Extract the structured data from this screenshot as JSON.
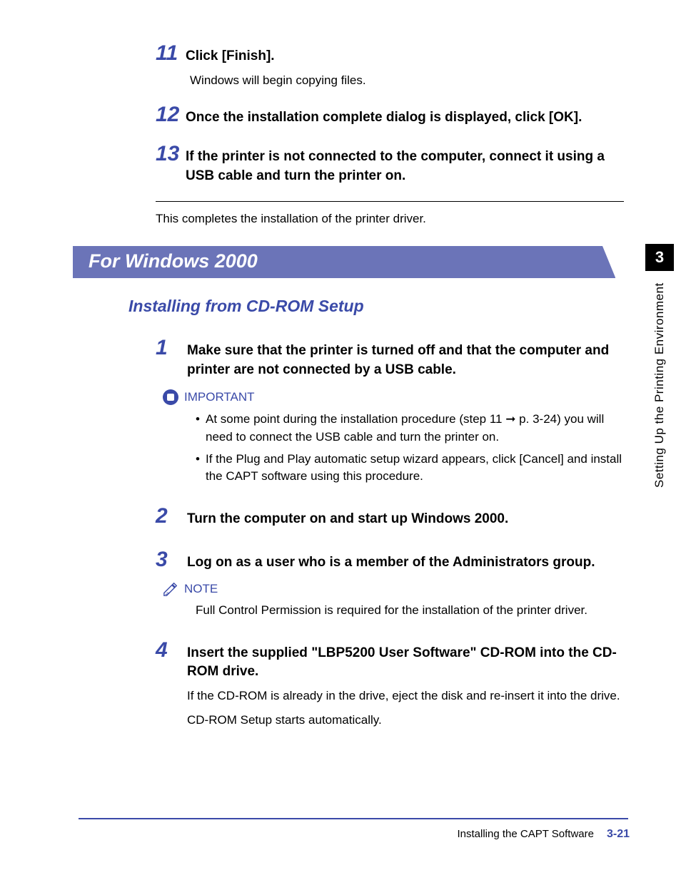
{
  "steps_top": [
    {
      "num": "11",
      "title": "Click [Finish].",
      "body": [
        "Windows will begin copying files."
      ]
    },
    {
      "num": "12",
      "title": "Once the installation complete dialog is displayed, click [OK].",
      "body": []
    },
    {
      "num": "13",
      "title": "If the printer is not connected to the computer, connect it using a USB cable and turn the printer on.",
      "body": []
    }
  ],
  "completion_text": "This completes the installation of the printer driver.",
  "section_heading": "For Windows 2000",
  "subsection_heading": "Installing from CD-ROM Setup",
  "steps_bottom": [
    {
      "num": "1",
      "title": "Make sure that the printer is turned off and that the computer and printer are not connected by a USB cable.",
      "callout": {
        "type": "important",
        "label": "IMPORTANT",
        "bullets": [
          "At some point during the installation procedure (step 11 ➞ p. 3-24) you will need to connect the USB cable and turn the printer on.",
          "If the Plug and Play automatic setup wizard appears, click [Cancel] and install the CAPT software using this procedure."
        ]
      }
    },
    {
      "num": "2",
      "title": "Turn the computer on and start up Windows 2000."
    },
    {
      "num": "3",
      "title": "Log on as a user who is a member of the Administrators group.",
      "callout": {
        "type": "note",
        "label": "NOTE",
        "text": "Full Control Permission is required for the installation of the printer driver."
      }
    },
    {
      "num": "4",
      "title": "Insert the supplied \"LBP5200 User Software\" CD-ROM into the CD-ROM drive.",
      "body": [
        "If the CD-ROM is already in the drive, eject the disk and re-insert it into the drive.",
        "CD-ROM Setup starts automatically."
      ]
    }
  ],
  "sidebar": {
    "chapter": "3",
    "label": "Setting Up the Printing Environment"
  },
  "footer": {
    "section": "Installing the CAPT Software",
    "page": "3-21"
  }
}
